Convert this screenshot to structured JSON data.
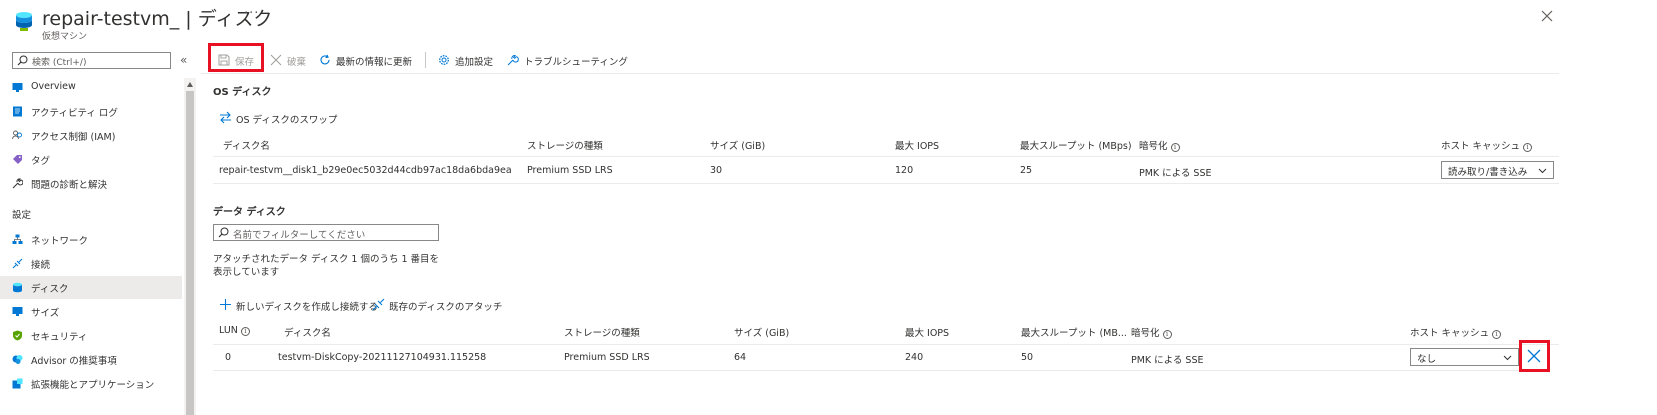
{
  "header": {
    "title": "repair-testvm_ | ディスク",
    "subtitle": "仮想マシン",
    "more": "···"
  },
  "sidebar": {
    "search_placeholder": "検索 (Ctrl+/)",
    "collapse": "«",
    "items": [
      {
        "label": "Overview",
        "icon": "monitor-icon"
      },
      {
        "label": "アクティビティ ログ",
        "icon": "activity-log-icon"
      },
      {
        "label": "アクセス制御 (IAM)",
        "icon": "people-icon"
      },
      {
        "label": "タグ",
        "icon": "tag-icon"
      },
      {
        "label": "問題の診断と解決",
        "icon": "wrench-icon"
      }
    ],
    "section_settings": "設定",
    "settings_items": [
      {
        "label": "ネットワーク",
        "icon": "network-icon"
      },
      {
        "label": "接続",
        "icon": "connect-icon"
      },
      {
        "label": "ディスク",
        "icon": "disk-icon",
        "selected": true
      },
      {
        "label": "サイズ",
        "icon": "monitor-icon"
      },
      {
        "label": "セキュリティ",
        "icon": "shield-icon"
      },
      {
        "label": "Advisor の推奨事項",
        "icon": "advisor-icon"
      },
      {
        "label": "拡張機能とアプリケーション",
        "icon": "extension-icon"
      }
    ]
  },
  "toolbar": {
    "save": "保存",
    "discard": "破棄",
    "refresh": "最新の情報に更新",
    "additional_settings": "追加設定",
    "troubleshoot": "トラブルシューティング"
  },
  "os_disk": {
    "title": "OS ディスク",
    "swap": "OS ディスクのスワップ",
    "columns": [
      "ディスク名",
      "ストレージの種類",
      "サイズ (GiB)",
      "最大 IOPS",
      "最大スループット (MBps)",
      "暗号化",
      "ホスト キャッシュ"
    ],
    "row": {
      "name": "repair-testvm__disk1_b29e0ec5032d44cdb97ac18da6bda9ea",
      "storage": "Premium SSD LRS",
      "size": "30",
      "iops": "120",
      "throughput": "25",
      "encryption": "PMK による SSE",
      "cache": "読み取り/書き込み"
    }
  },
  "data_disk": {
    "title": "データ ディスク",
    "filter_placeholder": "名前でフィルターしてください",
    "count_text": "アタッチされたデータ ディスク 1 個のうち 1 番目を表示しています",
    "create_attach": "新しいディスクを作成し接続する",
    "attach_existing": "既存のディスクのアタッチ",
    "columns": [
      "LUN",
      "ディスク名",
      "ストレージの種類",
      "サイズ (GiB)",
      "最大 IOPS",
      "最大スループット (MB...",
      "暗号化",
      "ホスト キャッシュ"
    ],
    "row": {
      "lun": "0",
      "name": "testvm-DiskCopy-20211127104931.115258",
      "storage": "Premium SSD LRS",
      "size": "64",
      "iops": "240",
      "throughput": "50",
      "encryption": "PMK による SSE",
      "cache": "なし"
    }
  },
  "info_glyph": "i",
  "colors": {
    "accent": "#0078d4",
    "highlight": "#e81123",
    "selected_bg": "#edebe9"
  }
}
